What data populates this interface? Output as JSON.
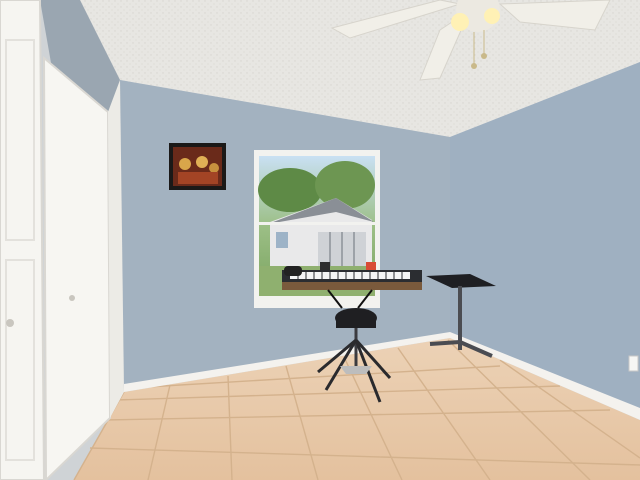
{
  "scene": {
    "description_hidden": "",
    "colors": {
      "ceiling": "#e7e6e2",
      "back_wall": "#a3b2c0",
      "right_wall": "#9fb0c1",
      "left_wall": "#9aa6b1",
      "floor": "#e8c9a8",
      "floor_grout": "#d7b793",
      "baseboard": "#f4f2ee",
      "closet_door": "#f6f5f1",
      "window_frame": "#f2f2ef",
      "keyboard": "#2b2d31",
      "stool_seat": "#1f1f22",
      "ceiling_fan": "#f1efe8",
      "fan_light": "#fff1b5"
    },
    "objects": [
      {
        "name": "ceiling-fan-icon"
      },
      {
        "name": "framed-picture-icon"
      },
      {
        "name": "window-icon"
      },
      {
        "name": "keyboard-icon"
      },
      {
        "name": "stool-icon"
      },
      {
        "name": "side-table-icon"
      },
      {
        "name": "closet-door-icon"
      },
      {
        "name": "outlet-icon"
      }
    ]
  }
}
